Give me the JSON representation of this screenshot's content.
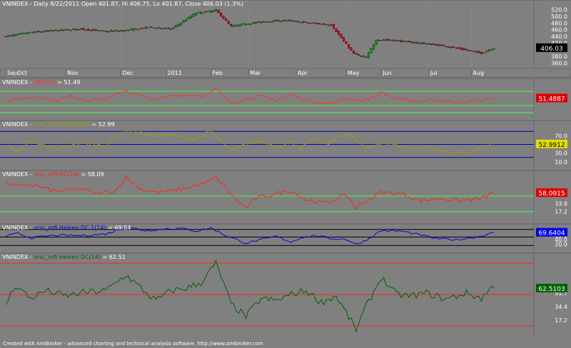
{
  "footer": "Created with AmiBroker - advanced charting and technical analysis software. http://www.amibroker.com",
  "chart_data": [
    {
      "type": "candlestick",
      "title": "VNINDEX - Daily 8/22/2011 Open 401.87, Hi 406.75, Lo 401.87, Close 406.03 (1.3%)",
      "last_value": "406.03",
      "y_ticks": [
        "520.0",
        "500.0",
        "480.0",
        "460.0",
        "440.0",
        "420.0",
        "400.0",
        "380.0",
        "360.0"
      ],
      "ylim": [
        352,
        528
      ],
      "x_labels": [
        "Sep",
        "Oct",
        "Nov",
        "Dec",
        "2011",
        "Feb",
        "Mar",
        "Apr",
        "May",
        "Jun",
        "Jul",
        "Aug"
      ],
      "x_label_positions": [
        0,
        4,
        24,
        46,
        64,
        82,
        97,
        116,
        136,
        150,
        169,
        186
      ],
      "n_bars": 196,
      "close_keypoints": [
        [
          0,
          440
        ],
        [
          10,
          452
        ],
        [
          20,
          458
        ],
        [
          30,
          462
        ],
        [
          40,
          455
        ],
        [
          48,
          458
        ],
        [
          58,
          468
        ],
        [
          66,
          462
        ],
        [
          76,
          510
        ],
        [
          84,
          518
        ],
        [
          90,
          470
        ],
        [
          96,
          478
        ],
        [
          104,
          485
        ],
        [
          112,
          488
        ],
        [
          120,
          481
        ],
        [
          130,
          475
        ],
        [
          135,
          425
        ],
        [
          139,
          388
        ],
        [
          144,
          375
        ],
        [
          148,
          430
        ],
        [
          155,
          428
        ],
        [
          165,
          420
        ],
        [
          175,
          412
        ],
        [
          185,
          397
        ],
        [
          190,
          390
        ],
        [
          195,
          406
        ]
      ],
      "colors": {
        "up": "#00a000",
        "down": "#d00000",
        "last_box": "#000000"
      }
    },
    {
      "type": "line",
      "title": "VNINDEX - MFI(14) = 51.49",
      "title_parts": [
        "VNINDEX - ",
        "MFI(14)",
        " = 51.49"
      ],
      "last_value": "51.4887",
      "y_ticks": [],
      "ylim": [
        0,
        100
      ],
      "ref_lines": [
        70,
        30,
        10
      ],
      "series_keypoints": [
        [
          0,
          42
        ],
        [
          6,
          50
        ],
        [
          12,
          55
        ],
        [
          20,
          45
        ],
        [
          26,
          56
        ],
        [
          32,
          45
        ],
        [
          40,
          48
        ],
        [
          48,
          72
        ],
        [
          55,
          55
        ],
        [
          60,
          45
        ],
        [
          66,
          58
        ],
        [
          74,
          60
        ],
        [
          80,
          58
        ],
        [
          84,
          75
        ],
        [
          90,
          36
        ],
        [
          96,
          50
        ],
        [
          102,
          55
        ],
        [
          108,
          45
        ],
        [
          114,
          62
        ],
        [
          118,
          48
        ],
        [
          124,
          40
        ],
        [
          130,
          35
        ],
        [
          136,
          50
        ],
        [
          144,
          45
        ],
        [
          150,
          67
        ],
        [
          156,
          48
        ],
        [
          166,
          42
        ],
        [
          172,
          46
        ],
        [
          180,
          38
        ],
        [
          186,
          42
        ],
        [
          190,
          45
        ],
        [
          195,
          51
        ]
      ],
      "colors": {
        "line": "#ff3030",
        "ref": "#40ff40",
        "last_box": "#e00000"
      }
    },
    {
      "type": "line",
      "title": "VNINDEX - srsc_mfi heiken(14) = 52.99",
      "title_parts": [
        "VNINDEX - ",
        "srsc_mfi heiken(14)",
        " = 52.99"
      ],
      "last_value": "52.9912",
      "y_ticks": [
        "70.0",
        "50.0",
        "30.0",
        "10.0"
      ],
      "ylim": [
        0,
        100
      ],
      "ref_lines": [
        80,
        50,
        20
      ],
      "series_keypoints": [
        [
          0,
          48
        ],
        [
          5,
          36
        ],
        [
          10,
          55
        ],
        [
          20,
          40
        ],
        [
          30,
          52
        ],
        [
          40,
          48
        ],
        [
          48,
          82
        ],
        [
          58,
          72
        ],
        [
          68,
          70
        ],
        [
          76,
          62
        ],
        [
          82,
          80
        ],
        [
          90,
          35
        ],
        [
          96,
          50
        ],
        [
          102,
          58
        ],
        [
          108,
          45
        ],
        [
          114,
          55
        ],
        [
          118,
          42
        ],
        [
          124,
          62
        ],
        [
          128,
          48
        ],
        [
          136,
          78
        ],
        [
          144,
          40
        ],
        [
          150,
          55
        ],
        [
          156,
          48
        ],
        [
          162,
          40
        ],
        [
          168,
          45
        ],
        [
          176,
          32
        ],
        [
          184,
          30
        ],
        [
          190,
          40
        ],
        [
          195,
          53
        ]
      ],
      "colors": {
        "line": "#a0a000",
        "ref": "#0000b0",
        "last_box": "#e0e000"
      }
    },
    {
      "type": "line",
      "title": "VNINDEX - srsc_mfi DC(14) = 58.09",
      "title_parts": [
        "VNINDEX - ",
        "srsc_mfi DC(14)",
        " = 58.09"
      ],
      "last_value": "58.0915",
      "y_ticks": [
        "33.9",
        "17.2"
      ],
      "ylim": [
        0,
        100
      ],
      "ref_lines": [
        50,
        17
      ],
      "series_keypoints": [
        [
          0,
          78
        ],
        [
          5,
          70
        ],
        [
          10,
          75
        ],
        [
          20,
          60
        ],
        [
          30,
          66
        ],
        [
          36,
          55
        ],
        [
          44,
          62
        ],
        [
          48,
          90
        ],
        [
          54,
          65
        ],
        [
          60,
          58
        ],
        [
          66,
          60
        ],
        [
          74,
          70
        ],
        [
          80,
          78
        ],
        [
          84,
          90
        ],
        [
          92,
          42
        ],
        [
          96,
          25
        ],
        [
          100,
          45
        ],
        [
          108,
          55
        ],
        [
          114,
          62
        ],
        [
          120,
          42
        ],
        [
          128,
          35
        ],
        [
          136,
          52
        ],
        [
          140,
          25
        ],
        [
          144,
          40
        ],
        [
          150,
          58
        ],
        [
          158,
          55
        ],
        [
          166,
          40
        ],
        [
          174,
          45
        ],
        [
          182,
          40
        ],
        [
          190,
          45
        ],
        [
          195,
          58
        ]
      ],
      "colors": {
        "line": "#ff2020",
        "ref": "#40ff40",
        "last_box": "#e00000"
      }
    },
    {
      "type": "line",
      "title": "VNINDEX - srsc_mfi Heiken DC 1(14) = 69.64",
      "title_parts": [
        "VNINDEX - ",
        "srsc_mfi Heiken DC 1(14)",
        " = 69.64"
      ],
      "last_value": "69.6404",
      "y_ticks": [
        "60.0",
        "40.0",
        "20.0"
      ],
      "ylim": [
        0,
        100
      ],
      "ref_lines": [
        85,
        52,
        15
      ],
      "series_keypoints": [
        [
          0,
          55
        ],
        [
          5,
          68
        ],
        [
          10,
          48
        ],
        [
          20,
          60
        ],
        [
          30,
          58
        ],
        [
          40,
          65
        ],
        [
          48,
          95
        ],
        [
          56,
          80
        ],
        [
          64,
          88
        ],
        [
          70,
          90
        ],
        [
          76,
          78
        ],
        [
          82,
          92
        ],
        [
          88,
          58
        ],
        [
          96,
          25
        ],
        [
          102,
          40
        ],
        [
          108,
          55
        ],
        [
          114,
          30
        ],
        [
          118,
          50
        ],
        [
          124,
          58
        ],
        [
          130,
          45
        ],
        [
          136,
          42
        ],
        [
          140,
          20
        ],
        [
          144,
          38
        ],
        [
          150,
          80
        ],
        [
          158,
          78
        ],
        [
          166,
          60
        ],
        [
          172,
          45
        ],
        [
          180,
          40
        ],
        [
          188,
          52
        ],
        [
          195,
          70
        ]
      ],
      "colors": {
        "line": "#0000e0",
        "ref": "#000000",
        "last_box": "#0000e0"
      }
    },
    {
      "type": "line",
      "title": "VNINDEX - srsc_mfi Heiken DC(14) = 62.51",
      "title_parts": [
        "VNINDEX - ",
        "srsc_mfi Heiken DC(14)",
        " = 62.51"
      ],
      "last_value": "62.5103",
      "y_ticks": [
        "51.7",
        "34.4",
        "17.2"
      ],
      "ylim": [
        0,
        100
      ],
      "ref_lines": [
        90,
        50,
        10
      ],
      "series_keypoints": [
        [
          0,
          38
        ],
        [
          4,
          62
        ],
        [
          10,
          45
        ],
        [
          16,
          55
        ],
        [
          24,
          48
        ],
        [
          30,
          52
        ],
        [
          40,
          55
        ],
        [
          48,
          75
        ],
        [
          54,
          58
        ],
        [
          60,
          42
        ],
        [
          66,
          55
        ],
        [
          72,
          58
        ],
        [
          78,
          65
        ],
        [
          84,
          90
        ],
        [
          90,
          38
        ],
        [
          96,
          22
        ],
        [
          102,
          45
        ],
        [
          108,
          42
        ],
        [
          114,
          50
        ],
        [
          120,
          55
        ],
        [
          126,
          40
        ],
        [
          132,
          48
        ],
        [
          140,
          5
        ],
        [
          144,
          35
        ],
        [
          150,
          72
        ],
        [
          156,
          50
        ],
        [
          162,
          48
        ],
        [
          168,
          52
        ],
        [
          176,
          44
        ],
        [
          184,
          52
        ],
        [
          190,
          45
        ],
        [
          195,
          62
        ]
      ],
      "colors": {
        "line": "#006000",
        "ref": "#ff2020",
        "last_box": "#006000"
      }
    }
  ]
}
